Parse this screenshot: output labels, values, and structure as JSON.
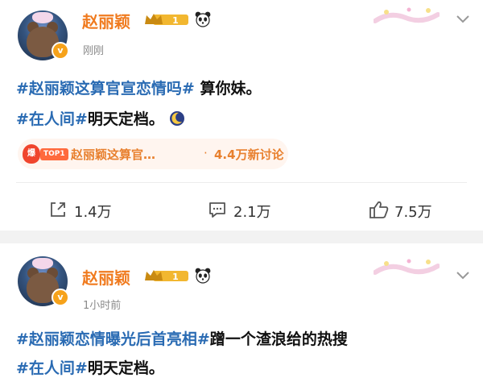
{
  "posts": [
    {
      "author": "赵丽颖",
      "vip_level": "1",
      "time": "刚刚",
      "line1": {
        "tag": "#赵丽颖这算官宣恋情吗#",
        "text": " 算你妹。"
      },
      "line2": {
        "tag": "#在人间#",
        "text": "明天定档。"
      },
      "trend": {
        "fire": "爆",
        "rank": "TOP1",
        "title": "赵丽颖这算官…",
        "dot": "·",
        "count": "4.4万新讨论"
      },
      "actions": {
        "share": "1.4万",
        "comment": "2.1万",
        "like": "7.5万"
      }
    },
    {
      "author": "赵丽颖",
      "vip_level": "1",
      "time": "1小时前",
      "line1": {
        "tag": "#赵丽颖恋情曝光后首亮相#",
        "text": "蹭一个渣浪给的热搜"
      },
      "line2": {
        "tag": "#在人间#",
        "text": "明天定档。"
      }
    }
  ],
  "icons": {
    "verified": "v-badge-icon",
    "crown": "crown-vip-icon",
    "panda": "panda-icon",
    "decoration": "card-decoration-icon",
    "chevron": "chevron-down-icon",
    "share": "share-icon",
    "comment": "comment-icon",
    "like": "thumbs-up-icon",
    "moon": "moon-emoji-icon"
  },
  "colors": {
    "author": "#f07b1f",
    "hashtag": "#2a6bb3",
    "trend_text": "#e8802e",
    "trend_bg": "#fff5ef",
    "verified": "#f6a21a"
  }
}
